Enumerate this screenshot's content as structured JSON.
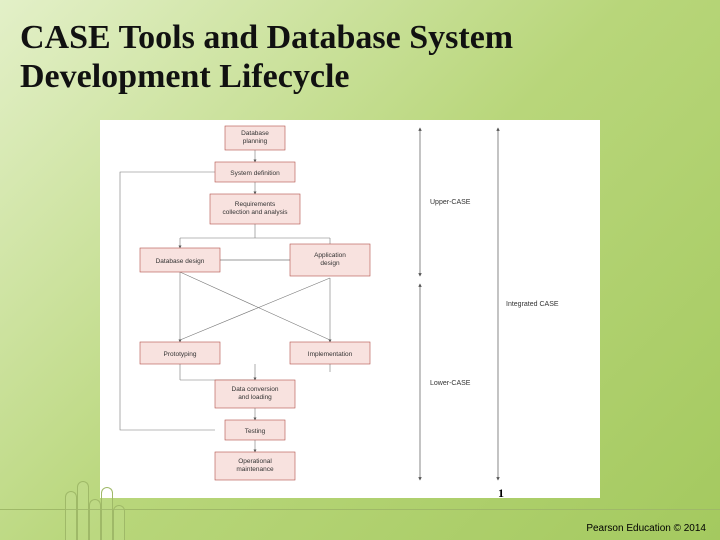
{
  "title_line1": "CASE Tools and Database System",
  "title_line2": "Development Lifecycle",
  "page_number": "1",
  "copyright": "Pearson Education © 2014",
  "diagram": {
    "boxes": {
      "db_planning": "Database\nplanning",
      "sys_def": "System definition",
      "req": "Requirements\ncollection and analysis",
      "db_design": "Database design",
      "app_design": "Application\ndesign",
      "proto": "Prototyping",
      "impl": "Implementation",
      "data_conv": "Data conversion\nand loading",
      "testing": "Testing",
      "op_maint": "Operational\nmaintenance"
    },
    "brackets": {
      "upper": "Upper-CASE",
      "lower": "Lower-CASE",
      "integrated": "Integrated CASE"
    }
  }
}
